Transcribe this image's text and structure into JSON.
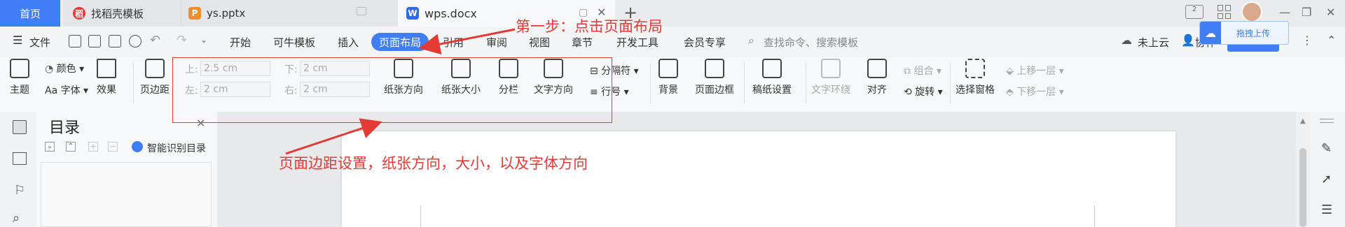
{
  "tabs": {
    "home": "首页",
    "t1": "找稻壳模板",
    "t2": "ys.pptx",
    "t3": "wps.docx"
  },
  "menu": {
    "file": "文件",
    "items": [
      "开始",
      "可牛模板",
      "插入",
      "页面布局",
      "引用",
      "审阅",
      "视图",
      "章节",
      "开发工具",
      "会员专享"
    ],
    "search_placeholder": "查找命令、搜索模板",
    "cloud": "未上云",
    "collab": "协作",
    "upload": "拖拽上传"
  },
  "ribbon": {
    "theme": "主题",
    "color": "颜色",
    "font": "字体",
    "effect": "效果",
    "margin": "页边距",
    "top_label": "上:",
    "top_value": "2.5 cm",
    "bottom_label": "下:",
    "bottom_value": "2 cm",
    "left_label": "左:",
    "left_value": "2 cm",
    "right_label": "右:",
    "right_value": "2 cm",
    "orientation": "纸张方向",
    "size": "纸张大小",
    "columns": "分栏",
    "text_dir": "文字方向",
    "breaks": "分隔符",
    "line_num": "行号",
    "background": "背景",
    "page_border": "页面边框",
    "manuscript": "稿纸设置",
    "wrap": "文字环绕",
    "align": "对齐",
    "group": "组合",
    "rotate": "旋转",
    "select_pane": "选择窗格",
    "bring_up": "上移一层",
    "send_down": "下移一层"
  },
  "toc": {
    "title": "目录",
    "smart": "智能识别目录"
  },
  "annotation": {
    "step1": "第一步：点击页面布局",
    "desc": "页面边距设置，纸张方向，大小，以及字体方向"
  },
  "colors": {
    "accent": "#3f7ef6",
    "annotation": "#e53935"
  }
}
